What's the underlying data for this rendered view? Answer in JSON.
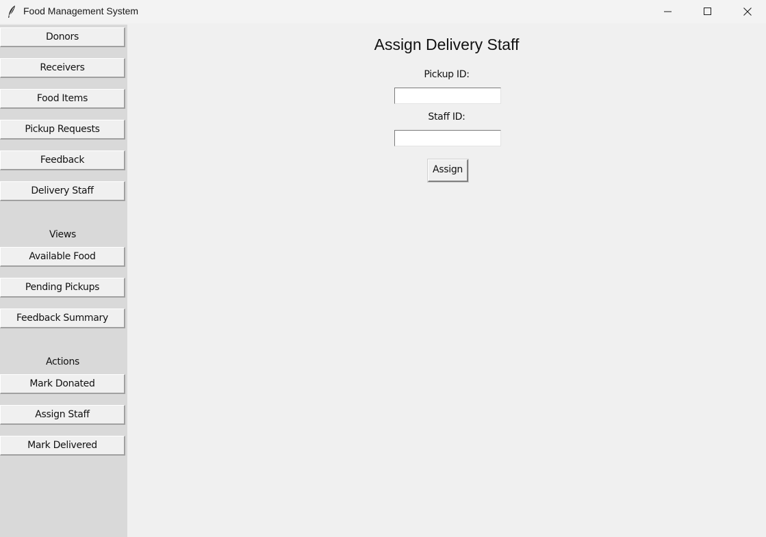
{
  "window": {
    "title": "Food Management System",
    "icon": "feather-icon"
  },
  "sidebar": {
    "entities": [
      {
        "label": "Donors"
      },
      {
        "label": "Receivers"
      },
      {
        "label": "Food Items"
      },
      {
        "label": "Pickup Requests"
      },
      {
        "label": "Feedback"
      },
      {
        "label": "Delivery Staff"
      }
    ],
    "views_heading": "Views",
    "views": [
      {
        "label": "Available Food"
      },
      {
        "label": "Pending Pickups"
      },
      {
        "label": "Feedback Summary"
      }
    ],
    "actions_heading": "Actions",
    "actions": [
      {
        "label": "Mark Donated"
      },
      {
        "label": "Assign Staff"
      },
      {
        "label": "Mark Delivered"
      }
    ]
  },
  "main": {
    "title": "Assign Delivery Staff",
    "pickup_label": "Pickup ID:",
    "pickup_value": "",
    "staff_label": "Staff ID:",
    "staff_value": "",
    "assign_label": "Assign"
  }
}
